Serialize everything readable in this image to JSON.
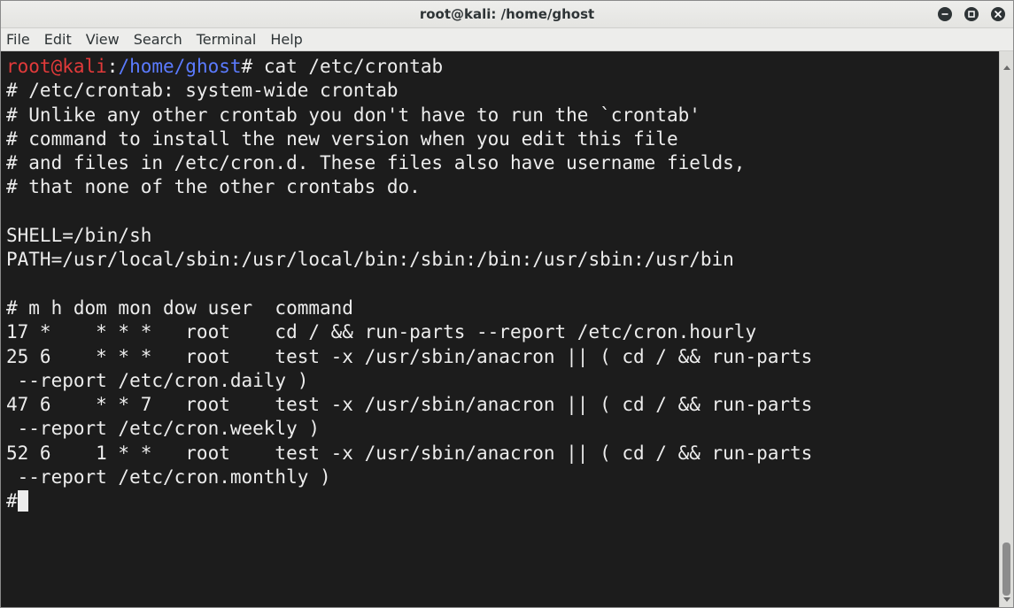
{
  "window": {
    "title": "root@kali: /home/ghost"
  },
  "menu": {
    "items": [
      {
        "label": "File"
      },
      {
        "label": "Edit"
      },
      {
        "label": "View"
      },
      {
        "label": "Search"
      },
      {
        "label": "Terminal"
      },
      {
        "label": "Help"
      }
    ]
  },
  "terminal": {
    "prompt": {
      "user_host": "root@kali",
      "separator": ":",
      "path": "/home/ghost",
      "symbol": "#",
      "command": " cat /etc/crontab"
    },
    "output": "# /etc/crontab: system-wide crontab\n# Unlike any other crontab you don't have to run the `crontab'\n# command to install the new version when you edit this file\n# and files in /etc/cron.d. These files also have username fields,\n# that none of the other crontabs do.\n\nSHELL=/bin/sh\nPATH=/usr/local/sbin:/usr/local/bin:/sbin:/bin:/usr/sbin:/usr/bin\n\n# m h dom mon dow user  command\n17 *    * * *   root    cd / && run-parts --report /etc/cron.hourly\n25 6    * * *   root    test -x /usr/sbin/anacron || ( cd / && run-parts\n --report /etc/cron.daily )\n47 6    * * 7   root    test -x /usr/sbin/anacron || ( cd / && run-parts\n --report /etc/cron.weekly )\n52 6    1 * *   root    test -x /usr/sbin/anacron || ( cd / && run-parts\n --report /etc/cron.monthly )\n#",
    "colors": {
      "background": "#1c1c1c",
      "foreground": "#ededed",
      "prompt_user": "#e23a3a",
      "prompt_path": "#5b7bff"
    }
  },
  "icons": {
    "minimize": "minimize-icon",
    "maximize": "maximize-icon",
    "close": "close-icon"
  }
}
